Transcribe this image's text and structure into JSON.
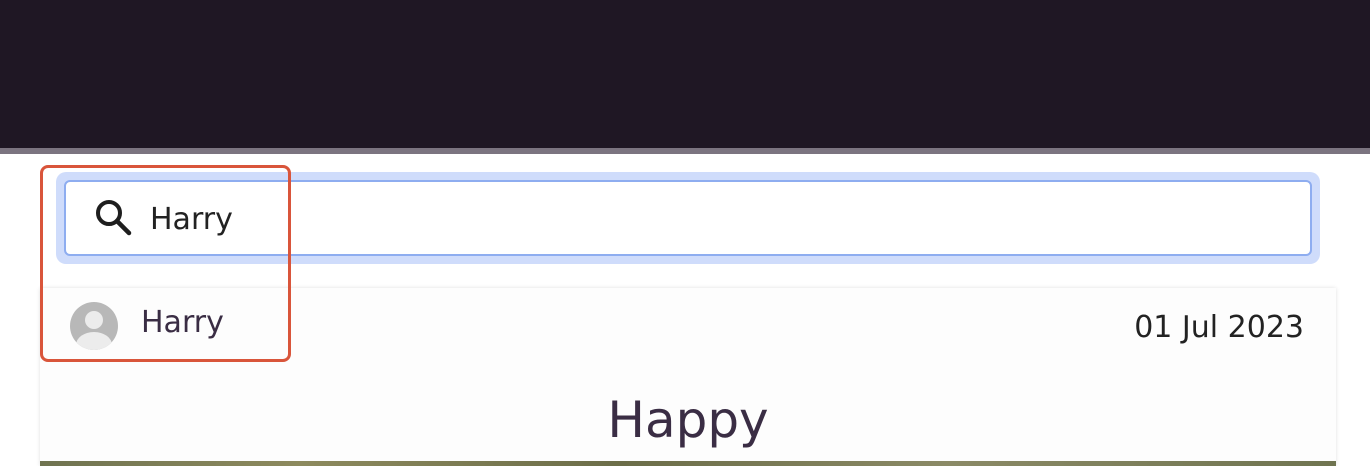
{
  "search": {
    "value": "Harry",
    "icon": "search-icon"
  },
  "post": {
    "author": "Harry",
    "date": "01 Jul 2023",
    "title": "Happy",
    "avatar_icon": "default-user-avatar"
  },
  "colors": {
    "topbar": "#1f1724",
    "search_focus_ring": "#cfdcfb",
    "search_border": "#8eadf0",
    "text_primary": "#3a2d44",
    "highlight": "#d9553b"
  }
}
